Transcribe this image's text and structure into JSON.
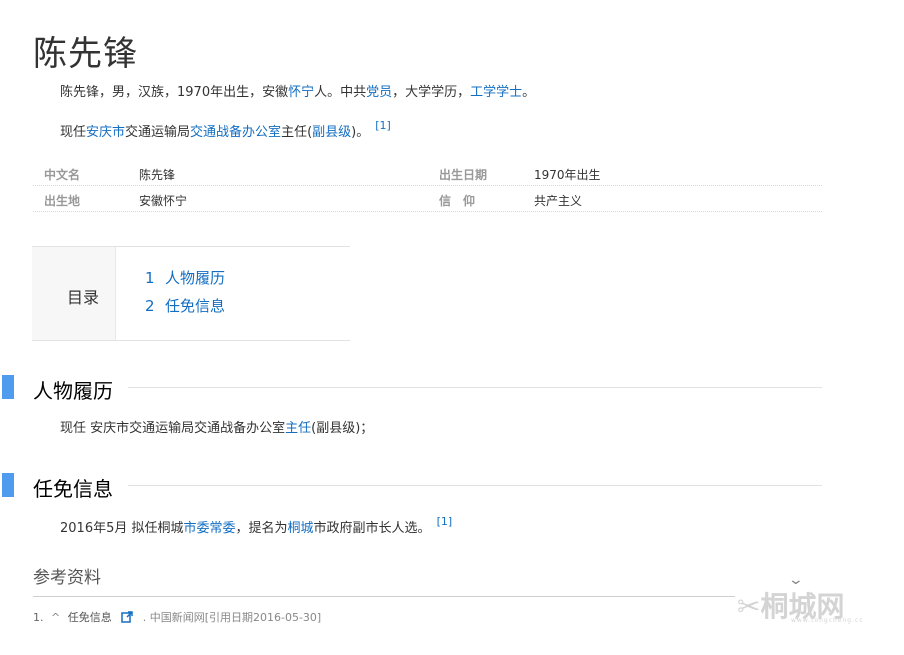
{
  "title": "陈先锋",
  "intro": {
    "p1": {
      "t1": "陈先锋，男，汉族，1970年出生，安徽",
      "l1": "怀宁",
      "t2": "人。中共",
      "l2": "党员",
      "t3": "，大学学历，",
      "l3": "工学学士",
      "t4": "。"
    },
    "p2": {
      "t1": "现任",
      "l1": "安庆市",
      "t2": "交通运输局",
      "l2": "交通战备办公室",
      "t3": "主任(",
      "l3": "副县级",
      "t4": ")。",
      "ref": "[1]"
    }
  },
  "basic_info": [
    {
      "label": "中文名",
      "value": "陈先锋",
      "label2": "出生日期",
      "value2": "1970年出生"
    },
    {
      "label": "出生地",
      "value": "安徽怀宁",
      "label2": "信　仰",
      "value2": "共产主义"
    }
  ],
  "toc": {
    "title": "目录",
    "items": [
      {
        "num": "1",
        "label": "人物履历"
      },
      {
        "num": "2",
        "label": "任免信息"
      }
    ]
  },
  "sections": [
    {
      "title": "人物履历",
      "text": {
        "t1": "现任 安庆市交通运输局交通战备办公室",
        "l1": "主任",
        "t2": "(副县级)；"
      }
    },
    {
      "title": "任免信息",
      "text": {
        "t1": "2016年5月 拟任桐城",
        "l1": "市委常委",
        "t2": "，提名为",
        "l2": "桐城",
        "t3": "市政府副市长人选。",
        "ref": "[1]"
      }
    }
  ],
  "references": {
    "title": "参考资料",
    "items": [
      {
        "num": "1.",
        "arrow": "^",
        "label": "任免信息",
        "source": ". 中国新闻网[引用日期2016-05-30]"
      }
    ]
  },
  "watermark": {
    "text": "桐城网",
    "sub": "www.tongcheng.cc"
  },
  "colors": {
    "link": "#136ec2",
    "section_bar": "#4f9cee"
  }
}
